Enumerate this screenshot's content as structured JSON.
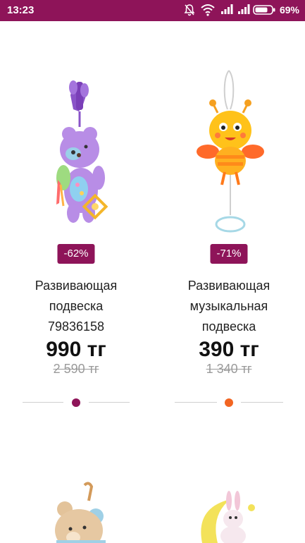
{
  "status_bar": {
    "time": "13:23",
    "battery_percent": "69%",
    "icons": [
      "bell-muted-icon",
      "wifi-icon",
      "signal-icon",
      "signal-icon",
      "battery-icon"
    ]
  },
  "products": [
    {
      "discount": "-62%",
      "name_lines": [
        "Развивающая",
        "подвеска",
        "79836158"
      ],
      "price": "990 тг",
      "old_price": "2 590 тг",
      "color_dot": "#8e1459",
      "image": "purple-bear-toy"
    },
    {
      "discount": "-71%",
      "name_lines": [
        "Развивающая",
        "музыкальная",
        "подвеска"
      ],
      "price": "390 тг",
      "old_price": "1 340 тг",
      "color_dot": "#f26522",
      "image": "bee-toy"
    }
  ],
  "next_row_images": [
    "teddy-bear-toy",
    "bunny-moon-toy"
  ],
  "colors": {
    "brand": "#8e1459",
    "accent_orange": "#f26522"
  }
}
